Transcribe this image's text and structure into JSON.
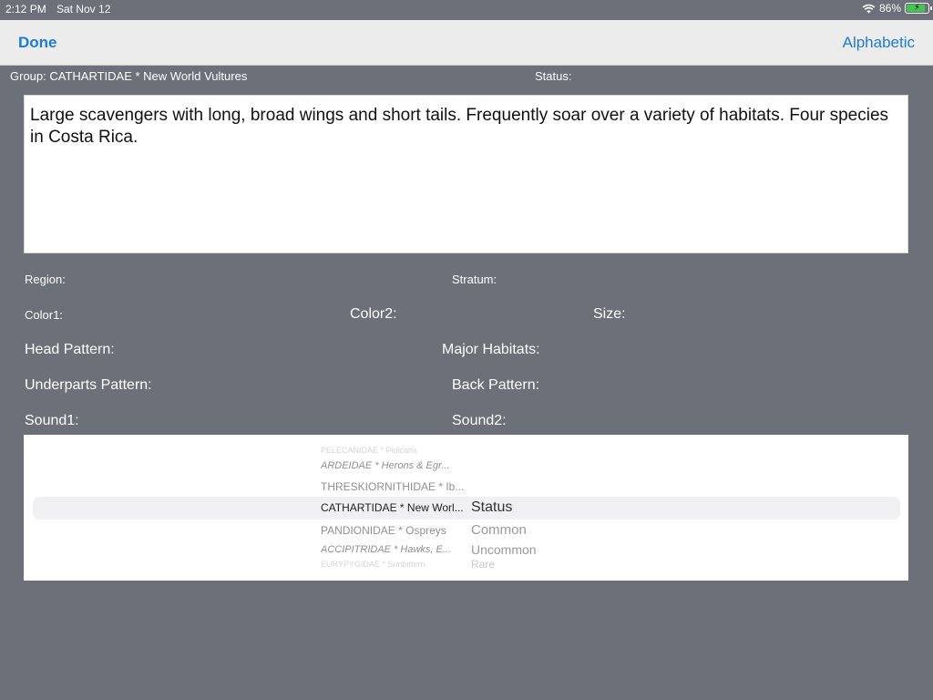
{
  "status_bar": {
    "time": "2:12 PM",
    "date": "Sat Nov 12",
    "battery": "86%",
    "battery_level": 0.86
  },
  "nav": {
    "done": "Done",
    "sort": "Alphabetic"
  },
  "header": {
    "group": "Group: CATHARTIDAE * New World Vultures",
    "status": "Status:"
  },
  "description": "Large scavengers with long, broad wings and short tails. Frequently soar over a variety of habitats. Four species in Costa Rica.",
  "fields": {
    "region": "Region:",
    "stratum": "Stratum:",
    "color1": "Color1:",
    "color2": "Color2:",
    "size": "Size:",
    "head_pattern": "Head Pattern:",
    "major_habitats": "Major Habitats:",
    "underparts_pattern": "Underparts Pattern:",
    "back_pattern": "Back Pattern:",
    "sound1": "Sound1:",
    "sound2": "Sound2:"
  },
  "picker": {
    "groups": [
      "PELECANIDAE * Pelicans",
      "ARDEIDAE * Herons & Egr...",
      "THRESKIORNITHIDAE * Ib...",
      "CATHARTIDAE * New Worl...",
      "PANDIONIDAE * Ospreys",
      "ACCIPITRIDAE * Hawks, E...",
      "EURYPYGIDAE * Sunbittern"
    ],
    "status": [
      "Status",
      "Common",
      "Uncommon",
      "Rare"
    ]
  }
}
